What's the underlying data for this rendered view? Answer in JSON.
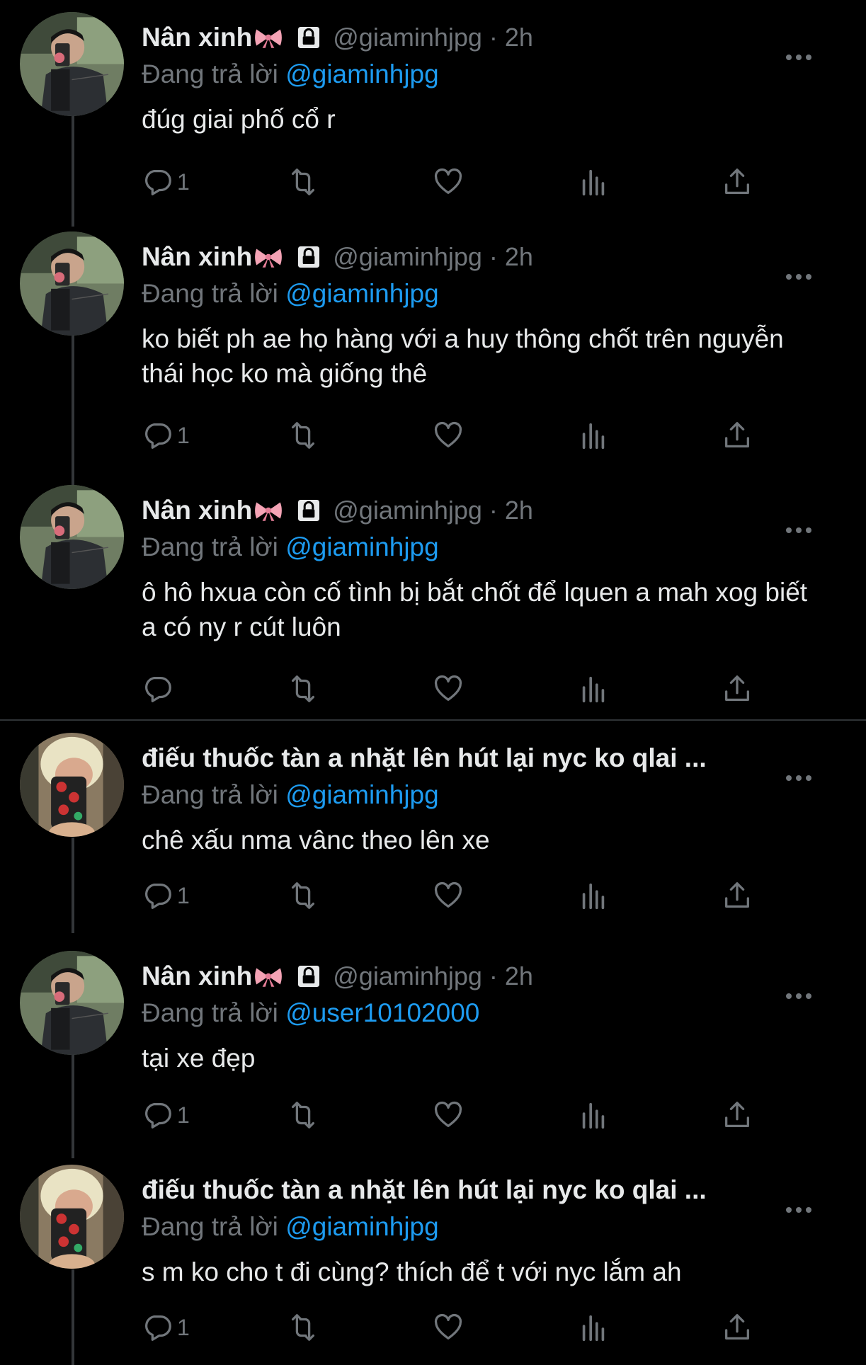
{
  "tweets": [
    {
      "name": "Nân xinh",
      "has_bow": true,
      "locked": true,
      "handle_time": "@giaminhjpg · 2h",
      "reply_prefix": "Đang trả lời",
      "reply_to": "@giaminhjpg",
      "text": "đúg giai phố cổ r",
      "reply_count": "1",
      "avatar": "boy-mirror-selfie"
    },
    {
      "name": "Nân xinh",
      "has_bow": true,
      "locked": true,
      "handle_time": "@giaminhjpg · 2h",
      "reply_prefix": "Đang trả lời",
      "reply_to": "@giaminhjpg",
      "text": "ko biết ph ae họ hàng với a huy thông chốt trên nguyễn thái học ko mà giống thê",
      "reply_count": "1",
      "avatar": "boy-mirror-selfie"
    },
    {
      "name": "Nân xinh",
      "has_bow": true,
      "locked": true,
      "handle_time": "@giaminhjpg · 2h",
      "reply_prefix": "Đang trả lời",
      "reply_to": "@giaminhjpg",
      "text": "ô hô hxua còn cố tình bị bắt chốt để lquen a mah xog biết a có ny r cút luôn",
      "reply_count": "",
      "avatar": "boy-mirror-selfie"
    },
    {
      "name": "điếu thuốc tàn a nhặt lên hút lại nyc ko qlai ...",
      "has_bow": false,
      "locked": false,
      "handle_time": "",
      "reply_prefix": "Đang trả lời",
      "reply_to": "@giaminhjpg",
      "text": "chê xấu nma vânc theo lên xe",
      "reply_count": "1",
      "avatar": "blonde-phone-selfie"
    },
    {
      "name": "Nân xinh",
      "has_bow": true,
      "locked": true,
      "handle_time": "@giaminhjpg · 2h",
      "reply_prefix": "Đang trả lời",
      "reply_to": "@user10102000",
      "text": "tại xe đẹp",
      "reply_count": "1",
      "avatar": "boy-mirror-selfie"
    },
    {
      "name": "điếu thuốc tàn a nhặt lên hút lại nyc ko qlai ...",
      "has_bow": false,
      "locked": false,
      "handle_time": "",
      "reply_prefix": "Đang trả lời",
      "reply_to": "@giaminhjpg",
      "text": "s m ko cho t đi cùng? thích để t với nyc lắm ah",
      "reply_count": "1",
      "avatar": "blonde-phone-selfie"
    }
  ],
  "icons": {
    "reply": "speech-bubble-icon",
    "retweet": "retweet-icon",
    "like": "heart-icon",
    "views": "bar-chart-icon",
    "share": "share-icon",
    "more": "more-dots-icon",
    "lock": "lock-icon",
    "bow": "pink-bow-emoji"
  },
  "colors": {
    "background": "#000000",
    "text": "#e7e9ea",
    "secondary": "#71767b",
    "mention": "#1d9bf0",
    "divider": "#2f3336"
  }
}
